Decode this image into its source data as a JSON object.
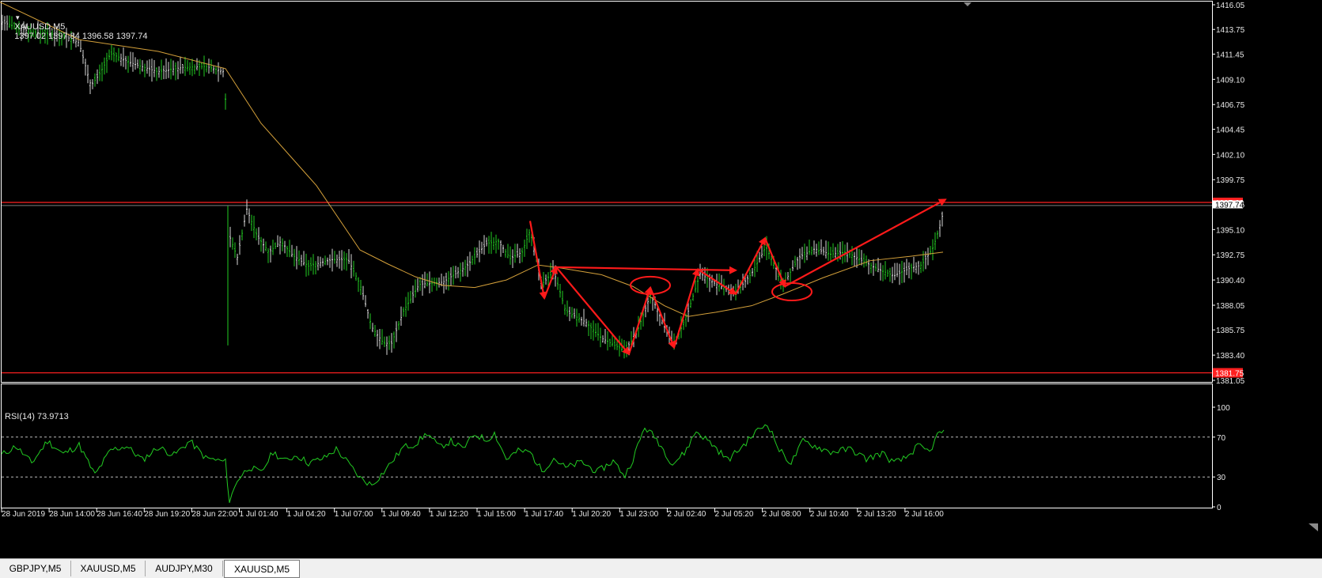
{
  "chart_header": {
    "arrow": "▼",
    "symbol": "XAUUSD,M5",
    "ohlc": "1397.02 1397.84 1396.58 1397.74"
  },
  "indicator_header": "RSI(14) 73.9713",
  "price_axis": [
    "1416.05",
    "1413.75",
    "1411.45",
    "1409.10",
    "1406.75",
    "1404.45",
    "1402.10",
    "1399.75",
    "1397.45",
    "1395.10",
    "1392.75",
    "1390.40",
    "1388.05",
    "1385.75",
    "1383.40",
    "1381.05"
  ],
  "price_tags": {
    "upper": "1397.63",
    "lower": "1381.75",
    "current": "1397.74"
  },
  "rsi_axis": [
    "100",
    "70",
    "30",
    "0"
  ],
  "time_axis": [
    "28 Jun 2019",
    "28 Jun 14:00",
    "28 Jun 16:40",
    "28 Jun 19:20",
    "28 Jun 22:00",
    "1 Jul 01:40",
    "1 Jul 04:20",
    "1 Jul 07:00",
    "1 Jul 09:40",
    "1 Jul 12:20",
    "1 Jul 15:00",
    "1 Jul 17:40",
    "1 Jul 20:20",
    "1 Jul 23:00",
    "2 Jul 02:40",
    "2 Jul 05:20",
    "2 Jul 08:00",
    "2 Jul 10:40",
    "2 Jul 13:20",
    "2 Jul 16:00"
  ],
  "tabs": [
    {
      "label": "GBPJPY,M5",
      "active": false
    },
    {
      "label": "XAUUSD,M5",
      "active": false
    },
    {
      "label": "AUDJPY,M30",
      "active": false
    },
    {
      "label": "XAUUSD,M5",
      "active": true
    }
  ],
  "colors": {
    "background": "#000000",
    "bar_up": "#22cc22",
    "ma_line": "#d4a03a",
    "rsi_line": "#22cc22",
    "annotation": "#ff1a1a",
    "hline": "#ff2020",
    "axis_text": "#e8e8e8",
    "grid_border": "#ffffff"
  },
  "chart_data": {
    "type": "line",
    "ylim": [
      1381.05,
      1416.05
    ],
    "ma_path_price": [
      [
        0,
        1416.3
      ],
      [
        100,
        1412.8
      ],
      [
        200,
        1411.7
      ],
      [
        285,
        1410.1
      ],
      [
        330,
        1405.0
      ],
      [
        400,
        1399.2
      ],
      [
        455,
        1393.2
      ],
      [
        490,
        1391.9
      ],
      [
        525,
        1390.7
      ],
      [
        560,
        1389.9
      ],
      [
        600,
        1389.7
      ],
      [
        640,
        1390.4
      ],
      [
        680,
        1391.8
      ],
      [
        710,
        1391.5
      ],
      [
        760,
        1390.9
      ],
      [
        800,
        1389.8
      ],
      [
        840,
        1388.0
      ],
      [
        870,
        1387.0
      ],
      [
        905,
        1387.4
      ],
      [
        950,
        1388.0
      ],
      [
        990,
        1389.1
      ],
      [
        1040,
        1390.6
      ],
      [
        1100,
        1392.2
      ],
      [
        1150,
        1392.6
      ],
      [
        1192,
        1393.0
      ]
    ],
    "rsi_path": [
      [
        2,
        52
      ],
      [
        20,
        61
      ],
      [
        40,
        44
      ],
      [
        60,
        66
      ],
      [
        80,
        53
      ],
      [
        100,
        62
      ],
      [
        120,
        32
      ],
      [
        140,
        57
      ],
      [
        160,
        61
      ],
      [
        180,
        47
      ],
      [
        200,
        60
      ],
      [
        220,
        52
      ],
      [
        240,
        66
      ],
      [
        260,
        49
      ],
      [
        285,
        45
      ],
      [
        290,
        5
      ],
      [
        300,
        27
      ],
      [
        315,
        40
      ],
      [
        330,
        34
      ],
      [
        345,
        55
      ],
      [
        360,
        46
      ],
      [
        375,
        52
      ],
      [
        390,
        44
      ],
      [
        410,
        49
      ],
      [
        425,
        58
      ],
      [
        440,
        44
      ],
      [
        455,
        29
      ],
      [
        470,
        22
      ],
      [
        485,
        35
      ],
      [
        495,
        45
      ],
      [
        510,
        60
      ],
      [
        525,
        63
      ],
      [
        540,
        74
      ],
      [
        555,
        60
      ],
      [
        570,
        66
      ],
      [
        585,
        58
      ],
      [
        600,
        73
      ],
      [
        615,
        67
      ],
      [
        625,
        74
      ],
      [
        640,
        48
      ],
      [
        655,
        56
      ],
      [
        670,
        55
      ],
      [
        685,
        36
      ],
      [
        700,
        49
      ],
      [
        715,
        39
      ],
      [
        735,
        45
      ],
      [
        755,
        35
      ],
      [
        775,
        46
      ],
      [
        790,
        31
      ],
      [
        800,
        48
      ],
      [
        815,
        80
      ],
      [
        830,
        68
      ],
      [
        850,
        43
      ],
      [
        865,
        54
      ],
      [
        880,
        76
      ],
      [
        900,
        63
      ],
      [
        920,
        47
      ],
      [
        940,
        62
      ],
      [
        955,
        75
      ],
      [
        970,
        84
      ],
      [
        985,
        57
      ],
      [
        1000,
        44
      ],
      [
        1015,
        66
      ],
      [
        1030,
        61
      ],
      [
        1050,
        55
      ],
      [
        1075,
        58
      ],
      [
        1095,
        48
      ],
      [
        1115,
        54
      ],
      [
        1130,
        44
      ],
      [
        1145,
        49
      ],
      [
        1160,
        61
      ],
      [
        1175,
        55
      ],
      [
        1185,
        72
      ],
      [
        1193,
        77
      ]
    ],
    "annotations": {
      "polyline_price": [
        [
          670,
          1395.9
        ],
        [
          688,
          1388.7
        ],
        [
          703,
          1391.6
        ],
        [
          795,
          1383.5
        ],
        [
          822,
          1389.7
        ],
        [
          852,
          1384.1
        ],
        [
          882,
          1391.4
        ],
        [
          930,
          1389.1
        ],
        [
          967,
          1394.3
        ],
        [
          992,
          1389.8
        ],
        [
          1195,
          1397.9
        ]
      ],
      "horizontal_arrow_price": [
        [
          700,
          1391.6
        ],
        [
          930,
          1391.3
        ]
      ],
      "ellipses_price": [
        [
          822,
          1389.9
        ],
        [
          1001,
          1389.3
        ]
      ]
    }
  }
}
